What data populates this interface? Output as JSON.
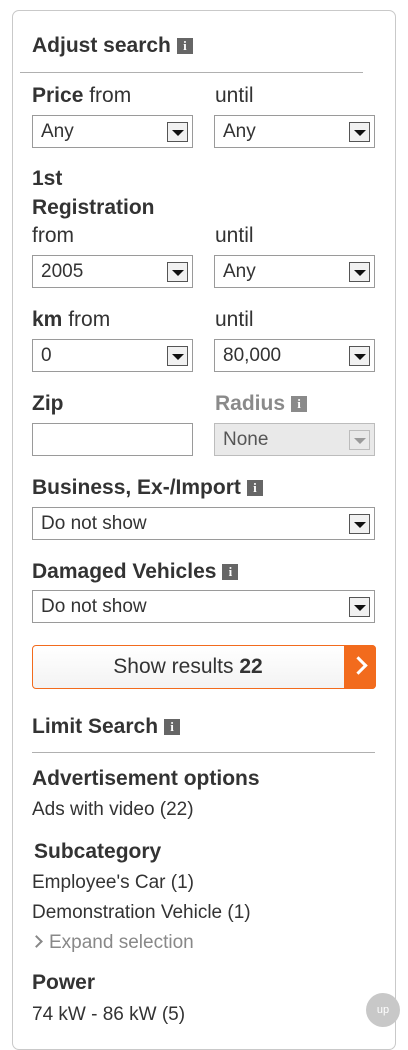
{
  "adjust": {
    "title": "Adjust search"
  },
  "price": {
    "label_bold": "Price",
    "label_from": "from",
    "until": "until",
    "from_value": "Any",
    "until_value": "Any"
  },
  "registration": {
    "line1": "1st",
    "line2": "Registration",
    "from": "from",
    "until": "until",
    "from_value": "2005",
    "until_value": "Any"
  },
  "km": {
    "label_bold": "km",
    "label_from": "from",
    "until": "until",
    "from_value": "0",
    "until_value": "80,000"
  },
  "zip": {
    "label": "Zip",
    "value": ""
  },
  "radius": {
    "label": "Radius",
    "value": "None"
  },
  "business": {
    "label": "Business, Ex-/Import",
    "value": "Do not show"
  },
  "damaged": {
    "label": "Damaged Vehicles",
    "value": "Do not show"
  },
  "results": {
    "label": "Show results",
    "count": "22"
  },
  "limit": {
    "title": "Limit Search"
  },
  "ad_options": {
    "title": "Advertisement options",
    "items": [
      "Ads with video (22)"
    ]
  },
  "subcategory": {
    "title": "Subcategory",
    "items": [
      "Employee's Car (1)",
      "Demonstration Vehicle (1)"
    ],
    "expand": "Expand selection"
  },
  "power": {
    "title": "Power",
    "items": [
      "74 kW - 86 kW (5)"
    ]
  },
  "scroll_button": {
    "label": "up"
  },
  "icons": {
    "info": "info-icon",
    "dropdown": "chevron-down-icon",
    "go": "chevron-right-icon"
  },
  "colors": {
    "accent": "#f26b1d",
    "text": "#333333",
    "muted": "#888888"
  }
}
